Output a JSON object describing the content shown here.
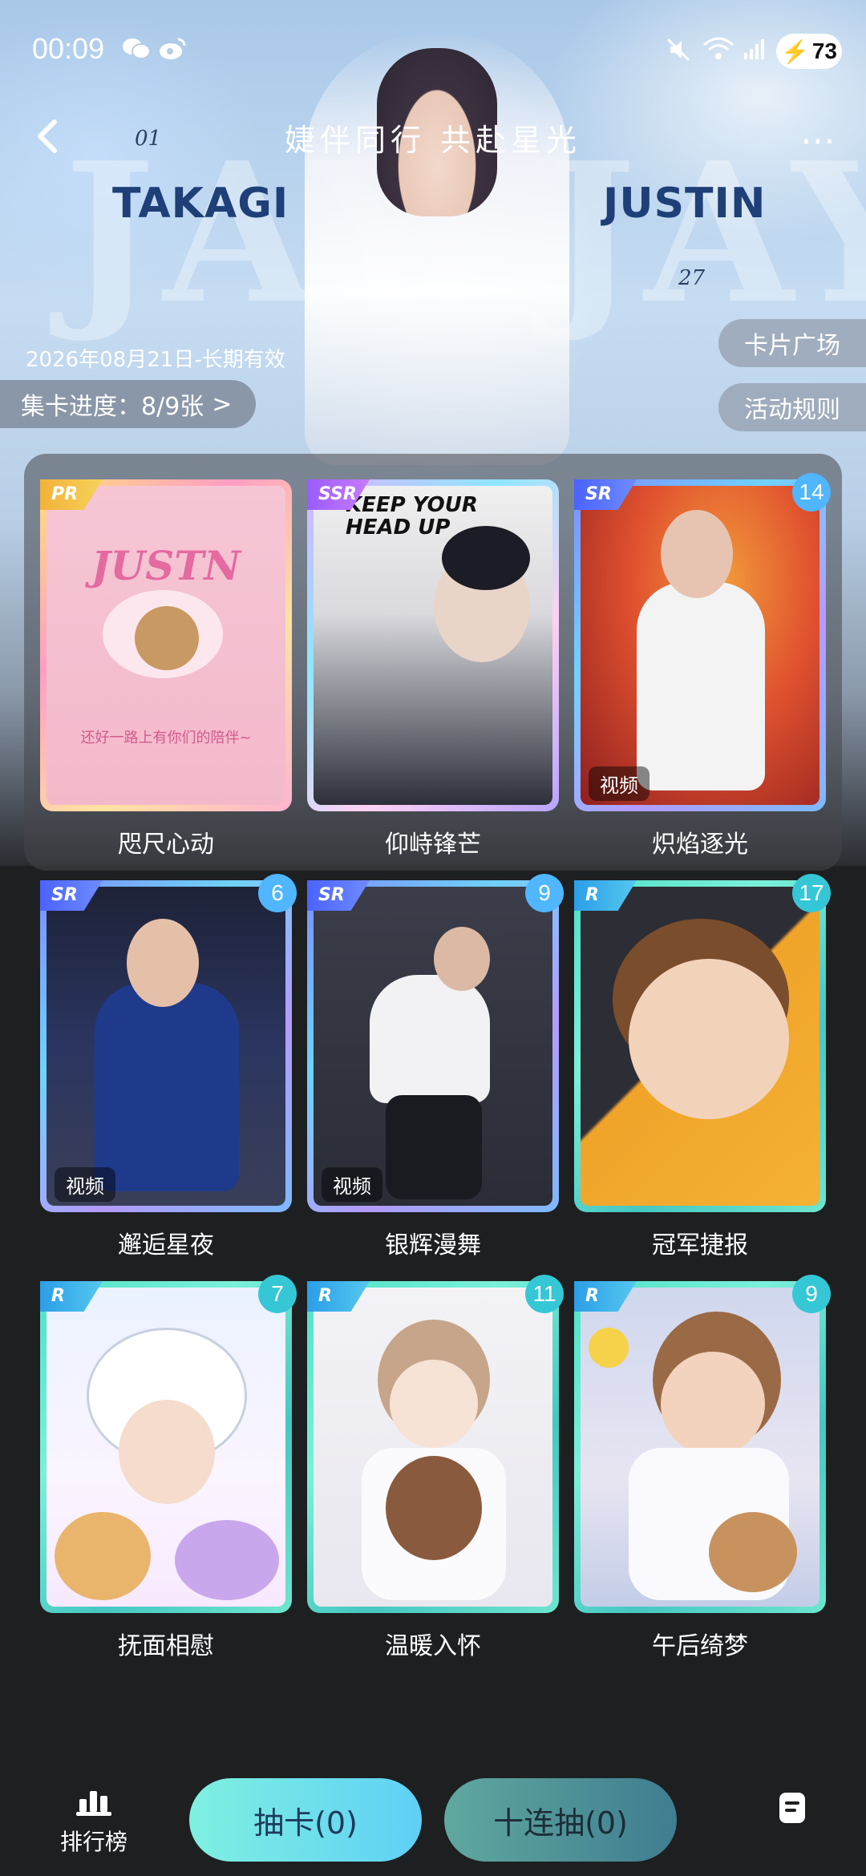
{
  "status_bar": {
    "time": "00:09",
    "battery": "73"
  },
  "header": {
    "title": "婕伴同行 共赴星光",
    "date_range": "2026年08月21日-长期有效",
    "progress": "集卡进度：8/9张",
    "progress_chevron": ">",
    "more": "⋯",
    "card_square_button": "卡片广场",
    "rules_button": "活动规则"
  },
  "banner": {
    "left_name": "TAKAGI",
    "right_name": "JUSTIN",
    "left_num": "01",
    "right_num": "27",
    "bg_word": "JAY"
  },
  "cards": [
    {
      "name": "咫尺心动",
      "rarity": "PR",
      "count": null,
      "video": false,
      "tagline": "还好一路上有你们的陪伴~",
      "logo": "JUSTN"
    },
    {
      "name": "仰峙锋芒",
      "rarity": "SSR",
      "count": null,
      "video": false,
      "tagline": "KEEP YOUR HEAD UP"
    },
    {
      "name": "炽焰逐光",
      "rarity": "SR",
      "count": "14",
      "video": true
    },
    {
      "name": "邂逅星夜",
      "rarity": "SR",
      "count": "6",
      "video": true
    },
    {
      "name": "银辉漫舞",
      "rarity": "SR",
      "count": "9",
      "video": true
    },
    {
      "name": "冠军捷报",
      "rarity": "R",
      "count": "17",
      "video": false
    },
    {
      "name": "抚面相慰",
      "rarity": "R",
      "count": "7",
      "video": false
    },
    {
      "name": "温暖入怀",
      "rarity": "R",
      "count": "11",
      "video": false
    },
    {
      "name": "午后绮梦",
      "rarity": "R",
      "count": "9",
      "video": false
    }
  ],
  "video_label": "视频",
  "bottom_bar": {
    "rank_label": "排行榜",
    "draw_label": "抽卡(0)",
    "draw10_label": "十连抽(0)"
  },
  "icons": {
    "back": "chevron-left-icon",
    "rank": "bar-chart-icon",
    "notes": "document-icon"
  }
}
